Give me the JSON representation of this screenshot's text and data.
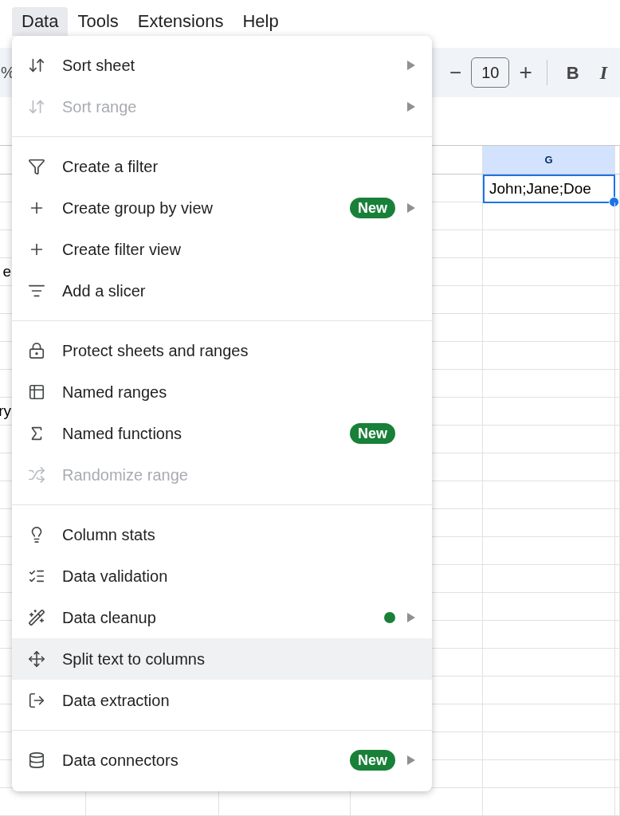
{
  "menu_bar": [
    {
      "label": "Data",
      "selected": true
    },
    {
      "label": "Tools",
      "selected": false
    },
    {
      "label": "Extensions",
      "selected": false
    },
    {
      "label": "Help",
      "selected": false
    }
  ],
  "toolbar": {
    "percent": "%",
    "decrease": "−",
    "font_size": "10",
    "increase": "+",
    "bold": "B",
    "italic": "I"
  },
  "sheet": {
    "column_header": "G",
    "selected_cell": {
      "text": "John;Jane;Doe",
      "selected": true
    },
    "column_a_fragments": [
      "e",
      "ry"
    ]
  },
  "data_menu": {
    "sections": [
      {
        "items": [
          {
            "label": "Sort sheet",
            "disabled": false,
            "submenu": true,
            "highlighted": false,
            "dot": false
          },
          {
            "label": "Sort range",
            "disabled": true,
            "submenu": true,
            "highlighted": false,
            "dot": false
          }
        ]
      },
      {
        "items": [
          {
            "label": "Create a filter",
            "disabled": false,
            "submenu": false,
            "highlighted": false,
            "dot": false
          },
          {
            "label": "Create group by view",
            "disabled": false,
            "submenu": true,
            "highlighted": false,
            "dot": false,
            "badge": "New"
          },
          {
            "label": "Create filter view",
            "disabled": false,
            "submenu": false,
            "highlighted": false,
            "dot": false
          },
          {
            "label": "Add a slicer",
            "disabled": false,
            "submenu": false,
            "highlighted": false,
            "dot": false
          }
        ]
      },
      {
        "items": [
          {
            "label": "Protect sheets and ranges",
            "disabled": false,
            "submenu": false,
            "highlighted": false,
            "dot": false
          },
          {
            "label": "Named ranges",
            "disabled": false,
            "submenu": false,
            "highlighted": false,
            "dot": false
          },
          {
            "label": "Named functions",
            "disabled": false,
            "submenu": false,
            "highlighted": false,
            "dot": false,
            "badge": "New"
          },
          {
            "label": "Randomize range",
            "disabled": true,
            "submenu": false,
            "highlighted": false,
            "dot": false
          }
        ]
      },
      {
        "items": [
          {
            "label": "Column stats",
            "disabled": false,
            "submenu": false,
            "highlighted": false,
            "dot": false
          },
          {
            "label": "Data validation",
            "disabled": false,
            "submenu": false,
            "highlighted": false,
            "dot": false
          },
          {
            "label": "Data cleanup",
            "disabled": false,
            "submenu": true,
            "highlighted": false,
            "dot": true
          },
          {
            "label": "Split text to columns",
            "disabled": false,
            "submenu": false,
            "highlighted": true,
            "dot": false
          },
          {
            "label": "Data extraction",
            "disabled": false,
            "submenu": false,
            "highlighted": false,
            "dot": false
          }
        ]
      },
      {
        "items": [
          {
            "label": "Data connectors",
            "disabled": false,
            "submenu": true,
            "highlighted": false,
            "dot": false,
            "badge": "New"
          }
        ]
      }
    ]
  }
}
